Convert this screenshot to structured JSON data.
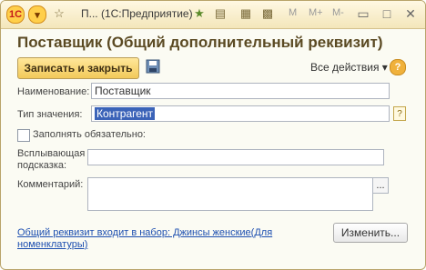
{
  "titlebar": {
    "title": "П... (1С:Предприятие)",
    "mm": [
      "M",
      "M+",
      "M-"
    ]
  },
  "form": {
    "header": "Поставщик (Общий дополнительный реквизит)",
    "save_close_label": "Записать и закрыть",
    "all_actions_label": "Все действия ▾",
    "help_icon": "?",
    "name_label": "Наименование:",
    "name_value": "Поставщик",
    "type_label": "Тип значения:",
    "type_value": "Контрагент",
    "type_help_icon": "?",
    "required_label": "Заполнять обязательно:",
    "tooltip_label_line1": "Всплывающая",
    "tooltip_label_line2": "подсказка:",
    "comment_label": "Комментарий:",
    "comment_button": "...",
    "set_link": "Общий реквизит входит в набор: Джинсы женские(Для номенклатуры)",
    "change_button": "Изменить..."
  }
}
